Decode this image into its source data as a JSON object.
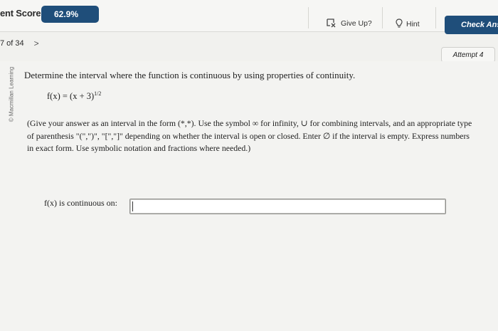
{
  "header": {
    "score_label": "ent Score:",
    "score_value": "62.9%",
    "give_up_label": "Give Up?",
    "hint_label": "Hint",
    "check_label": "Check Answ"
  },
  "nav": {
    "question_position": "7 of 34",
    "next_symbol": ">"
  },
  "attempt_label": "Attempt 4",
  "watermark": "© Macmillan Learning",
  "question": {
    "prompt": "Determine the interval where the function is continuous by using properties of continuity.",
    "function_lhs": "f(x) = (x + 3)",
    "function_exponent": "1/2",
    "instructions": "(Give your answer as an interval in the form (*,*). Use the symbol ∞ for infinity, ∪ for combining intervals, and an appropriate type of parenthesis \"(\",\")\", \"[\",\"]\" depending on whether the interval is open or closed. Enter ∅ if the interval is empty. Express numbers in exact form. Use symbolic notation and fractions where needed.)"
  },
  "answer": {
    "label": "f(x) is continuous on:",
    "value": "",
    "placeholder": ""
  },
  "colors": {
    "brand": "#1f4e7a",
    "background": "#f1f1ee"
  }
}
